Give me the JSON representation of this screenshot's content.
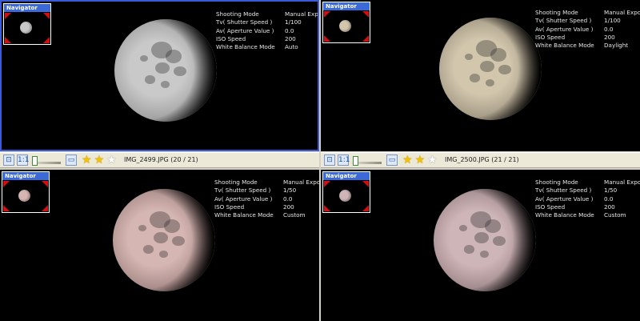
{
  "navigator_title": "Navigator",
  "info_labels": {
    "mode": "Shooting Mode",
    "tv": "Tv( Shutter Speed )",
    "av": "Av( Aperture Value )",
    "iso": "ISO Speed",
    "wb": "White Balance Mode"
  },
  "panes": [
    {
      "mode": "Manual Exposure",
      "tv": "1/100",
      "av": "0.0",
      "iso": "200",
      "wb": "Auto",
      "moon_color": "#c9c9c9",
      "moon_edge": "#8f8f8f",
      "active": true
    },
    {
      "mode": "Manual Exposure",
      "tv": "1/100",
      "av": "0.0",
      "iso": "200",
      "wb": "Daylight",
      "moon_color": "#d2c6ad",
      "moon_edge": "#8f8572",
      "active": false
    },
    {
      "mode": "Manual Exposure",
      "tv": "1/50",
      "av": "0.0",
      "iso": "200",
      "wb": "Custom",
      "moon_color": "#d6b6b3",
      "moon_edge": "#927775",
      "active": false
    },
    {
      "mode": "Manual Exposure",
      "tv": "1/50",
      "av": "0.0",
      "iso": "200",
      "wb": "Custom",
      "moon_color": "#ceb5b8",
      "moon_edge": "#8c7679",
      "active": false
    }
  ],
  "toolbars": [
    {
      "filename": "IMG_2499.JPG (20 / 21)",
      "rating": 2,
      "max_rating": 3
    },
    {
      "filename": "IMG_2500.JPG (21 / 21)",
      "rating": 2,
      "max_rating": 3
    }
  ],
  "icons": [
    "fit-to-window-icon",
    "actual-size-icon",
    "zoom-slider",
    "thumbnail-view-icon",
    "star-icon"
  ]
}
